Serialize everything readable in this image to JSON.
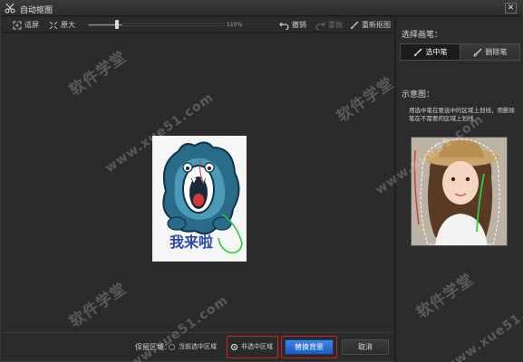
{
  "window": {
    "title": "自动抠图",
    "close_symbol": "✕"
  },
  "toolbar": {
    "fit_label": "适屏",
    "original_label": "原大",
    "zoom_value": "110%",
    "zoom_level": 0.25,
    "undo_label": "撤销",
    "redo_label": "重做",
    "redraw_label": "重新抠图"
  },
  "right_panel": {
    "brush_title": "选择画笔：",
    "select_brush_label": "选中笔",
    "erase_brush_label": "删除笔",
    "example_title": "示意图：",
    "hint_text": "用选中笔在要选中的区域上划线，用删除笔在不需要的区域上划线"
  },
  "canvas": {
    "image_caption": "我来啦"
  },
  "bottom_bar": {
    "keep_label": "保留区域：",
    "option_current": "当前选中区域",
    "option_non_selected": "非选中区域",
    "selected_option": "non_selected",
    "replace_button": "替换背景",
    "cancel_button": "取消"
  },
  "watermark": {
    "chinese": "软件学堂",
    "url": "www.xue51.com"
  },
  "colors": {
    "accent_blue": "#2b6fd0",
    "highlight_red": "#d62020",
    "panel_bg": "#2c2c2c"
  },
  "icons": {
    "fit": "expand-icon",
    "original": "one-to-one-icon",
    "undo": "undo-arrow-icon",
    "redo": "redo-arrow-icon",
    "redraw": "brush-icon",
    "select_brush": "brush-icon",
    "erase_brush": "eraser-icon"
  }
}
